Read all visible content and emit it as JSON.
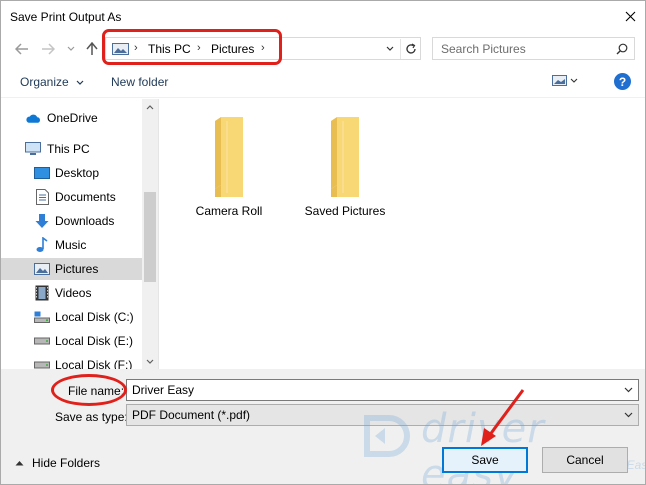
{
  "window": {
    "title": "Save Print Output As"
  },
  "address": {
    "segments": [
      "This PC",
      "Pictures"
    ]
  },
  "search": {
    "placeholder": "Search Pictures"
  },
  "toolbar": {
    "organize_label": "Organize",
    "new_folder_label": "New folder"
  },
  "navpane": {
    "items": [
      {
        "label": "OneDrive",
        "icon": "onedrive-icon"
      },
      {
        "label": "This PC",
        "icon": "computer-icon"
      },
      {
        "label": "Desktop",
        "icon": "desktop-icon"
      },
      {
        "label": "Documents",
        "icon": "documents-icon"
      },
      {
        "label": "Downloads",
        "icon": "download-icon"
      },
      {
        "label": "Music",
        "icon": "music-icon"
      },
      {
        "label": "Pictures",
        "icon": "pictures-icon",
        "selected": true
      },
      {
        "label": "Videos",
        "icon": "videos-icon"
      },
      {
        "label": "Local Disk (C:)",
        "icon": "drive-icon"
      },
      {
        "label": "Local Disk (E:)",
        "icon": "drive-icon"
      },
      {
        "label": "Local Disk (F:)",
        "icon": "drive-icon"
      }
    ]
  },
  "content": {
    "folders": [
      {
        "label": "Camera Roll"
      },
      {
        "label": "Saved Pictures"
      }
    ]
  },
  "form": {
    "file_name_label": "File name:",
    "file_name_value": "Driver Easy",
    "save_type_label": "Save as type:",
    "save_type_value": "PDF Document (*.pdf)"
  },
  "footer": {
    "hide_folders_label": "Hide Folders",
    "save_label": "Save",
    "cancel_label": "Cancel"
  },
  "watermark": {
    "text": "driver easy",
    "url": "www.DriverEasy.com"
  },
  "colors": {
    "annotation_red": "#e0201b",
    "accent_blue": "#0078d7",
    "folder_yellow": "#f8d775"
  }
}
